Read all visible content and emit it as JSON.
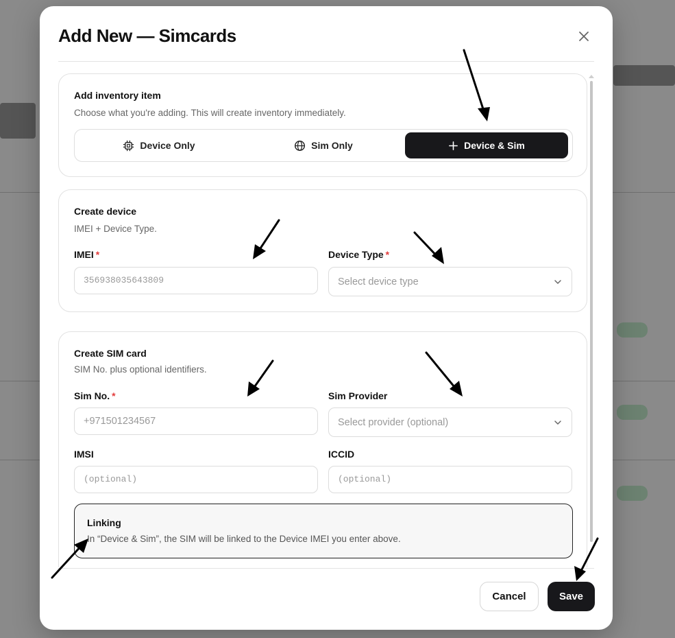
{
  "modal": {
    "title": "Add New — Simcards"
  },
  "inventory": {
    "title": "Add inventory item",
    "subtitle": "Choose what you're adding. This will create inventory immediately.",
    "options": [
      {
        "label": "Device Only",
        "icon": "chip-icon"
      },
      {
        "label": "Sim Only",
        "icon": "globe-icon"
      },
      {
        "label": "Device & Sim",
        "icon": "plus-icon",
        "selected": true
      }
    ]
  },
  "device": {
    "title": "Create device",
    "subtitle": "IMEI + Device Type.",
    "imei_label": "IMEI",
    "imei_placeholder": "356938035643809",
    "type_label": "Device Type",
    "type_placeholder": "Select device type"
  },
  "sim": {
    "title": "Create SIM card",
    "subtitle": "SIM No. plus optional identifiers.",
    "simno_label": "Sim No.",
    "simno_placeholder": "+971501234567",
    "provider_label": "Sim Provider",
    "provider_placeholder": "Select provider (optional)",
    "imsi_label": "IMSI",
    "imsi_placeholder": "(optional)",
    "iccid_label": "ICCID",
    "iccid_placeholder": "(optional)",
    "required_mark": "*"
  },
  "linking": {
    "title": "Linking",
    "text": "In “Device & Sim”, the SIM will be linked to the Device IMEI you enter above."
  },
  "footer": {
    "cancel_label": "Cancel",
    "save_label": "Save"
  },
  "colors": {
    "accent": "#18181b",
    "required": "#e23b3b"
  }
}
